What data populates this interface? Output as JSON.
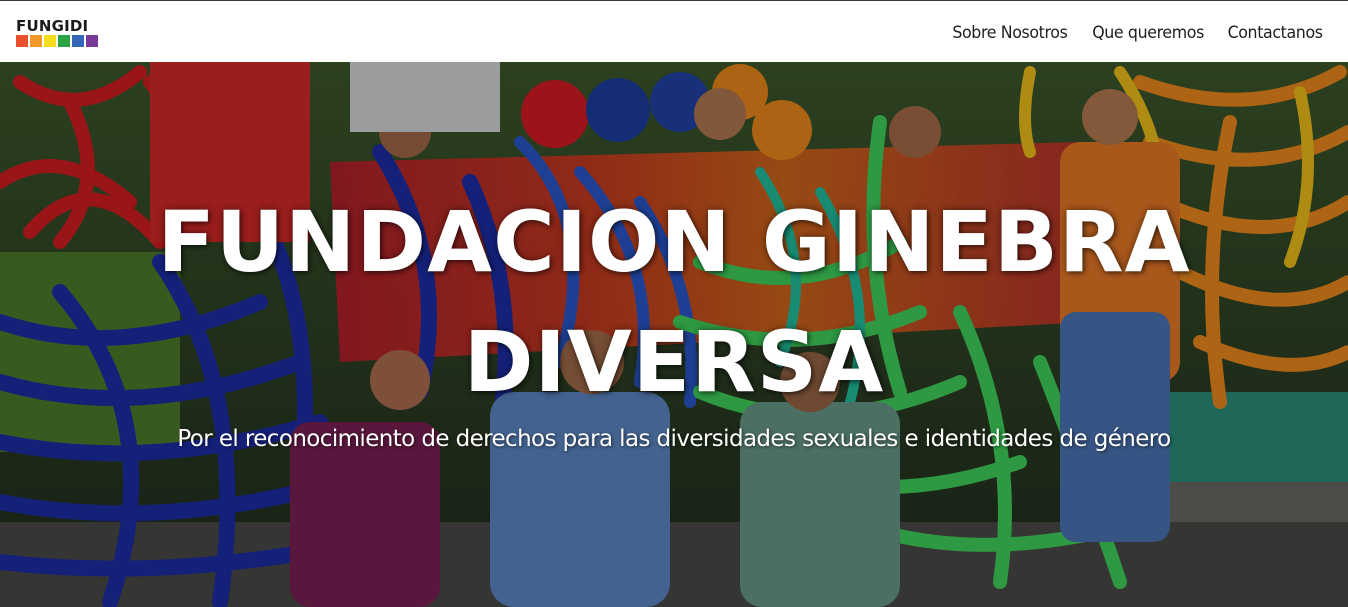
{
  "brand": {
    "name": "FUNGIDI",
    "stripe_colors": [
      "#e8512b",
      "#f19a2a",
      "#f4dc1c",
      "#2aa443",
      "#3667b7",
      "#7b3a98"
    ]
  },
  "nav": {
    "items": [
      {
        "label": "Sobre Nosotros"
      },
      {
        "label": "Que queremos"
      },
      {
        "label": "Contactanos"
      }
    ]
  },
  "hero": {
    "title_line1": "FUNDACION GINEBRA",
    "title_line2": "DIVERSA",
    "subtitle": "Por el reconocimiento de derechos para las diversidades sexuales e identidades de género"
  },
  "colors": {
    "title": "#ffffff",
    "nav_text": "#1e1e1e",
    "navbar_bg": "#ffffff"
  }
}
